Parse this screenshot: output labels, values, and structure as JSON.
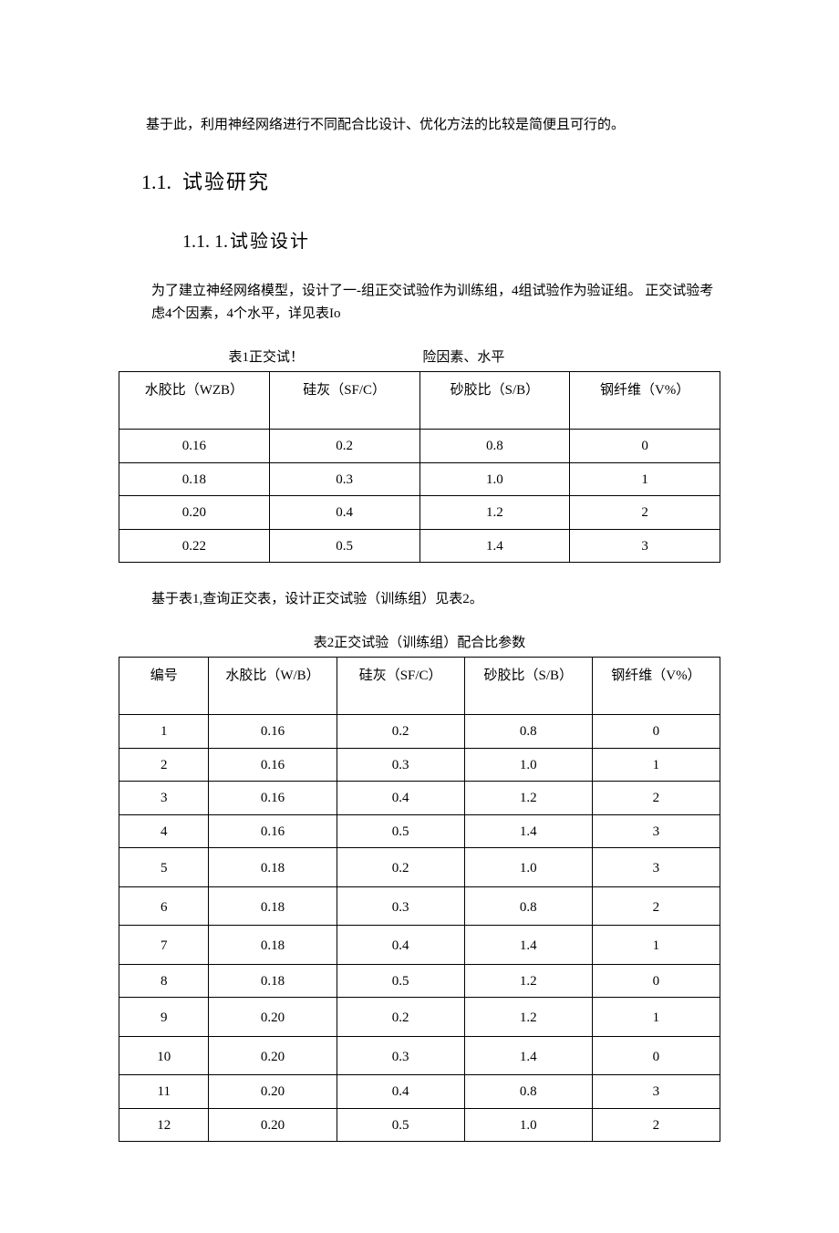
{
  "intro": "基于此，利用神经网络进行不同配合比设计、优化方法的比较是简便且可行的。",
  "heading_section_num": "1.1.",
  "heading_section_txt": "试验研究",
  "heading_sub_num": "1.1.  1.",
  "heading_sub_txt": "试验设计",
  "para_design_1": "为了建立神经网络模型，设计了一-组正交试验作为训练组，4组试验作为验证组。 正交试验考虑4个因素，4个水平，详见表Io",
  "table1_caption_left": "表1正交试！",
  "table1_caption_right": "险因素、水平",
  "table1": {
    "headers": [
      "水胶比（WZB）",
      "硅灰（SF/C）",
      "砂胶比（S/B）",
      "钢纤维（V%）"
    ],
    "rows": [
      [
        "0.16",
        "0.2",
        "0.8",
        "0"
      ],
      [
        "0.18",
        "0.3",
        "1.0",
        "1"
      ],
      [
        "0.20",
        "0.4",
        "1.2",
        "2"
      ],
      [
        "0.22",
        "0.5",
        "1.4",
        "3"
      ]
    ]
  },
  "mid_note": "基于表1,查询正交表，设计正交试验（训练组）见表2。",
  "table2_caption": "表2正交试验（训练组）配合比参数",
  "table2": {
    "headers": [
      "编号",
      "水胶比（W/B）",
      "硅灰（SF/C）",
      "砂胶比（S/B）",
      "钢纤维（V%）"
    ],
    "rows": [
      [
        "1",
        "0.16",
        "0.2",
        "0.8",
        "0"
      ],
      [
        "2",
        "0.16",
        "0.3",
        "1.0",
        "1"
      ],
      [
        "3",
        "0.16",
        "0.4",
        "1.2",
        "2"
      ],
      [
        "4",
        "0.16",
        "0.5",
        "1.4",
        "3"
      ],
      [
        "5",
        "0.18",
        "0.2",
        "1.0",
        "3"
      ],
      [
        "6",
        "0.18",
        "0.3",
        "0.8",
        "2"
      ],
      [
        "7",
        "0.18",
        "0.4",
        "1.4",
        "1"
      ],
      [
        "8",
        "0.18",
        "0.5",
        "1.2",
        "0"
      ],
      [
        "9",
        "0.20",
        "0.2",
        "1.2",
        "1"
      ],
      [
        "10",
        "0.20",
        "0.3",
        "1.4",
        "0"
      ],
      [
        "11",
        "0.20",
        "0.4",
        "0.8",
        "3"
      ],
      [
        "12",
        "0.20",
        "0.5",
        "1.0",
        "2"
      ]
    ]
  },
  "chart_data": [
    {
      "type": "table",
      "title": "表1 正交试险因素、水平",
      "headers": [
        "水胶比（WZB）",
        "硅灰（SF/C）",
        "砂胶比（S/B）",
        "钢纤维（V%）"
      ],
      "rows": [
        [
          0.16,
          0.2,
          0.8,
          0
        ],
        [
          0.18,
          0.3,
          1.0,
          1
        ],
        [
          0.2,
          0.4,
          1.2,
          2
        ],
        [
          0.22,
          0.5,
          1.4,
          3
        ]
      ]
    },
    {
      "type": "table",
      "title": "表2 正交试验（训练组）配合比参数",
      "headers": [
        "编号",
        "水胶比（W/B）",
        "硅灰（SF/C）",
        "砂胶比（S/B）",
        "钢纤维（V%）"
      ],
      "rows": [
        [
          1,
          0.16,
          0.2,
          0.8,
          0
        ],
        [
          2,
          0.16,
          0.3,
          1.0,
          1
        ],
        [
          3,
          0.16,
          0.4,
          1.2,
          2
        ],
        [
          4,
          0.16,
          0.5,
          1.4,
          3
        ],
        [
          5,
          0.18,
          0.2,
          1.0,
          3
        ],
        [
          6,
          0.18,
          0.3,
          0.8,
          2
        ],
        [
          7,
          0.18,
          0.4,
          1.4,
          1
        ],
        [
          8,
          0.18,
          0.5,
          1.2,
          0
        ],
        [
          9,
          0.2,
          0.2,
          1.2,
          1
        ],
        [
          10,
          0.2,
          0.3,
          1.4,
          0
        ],
        [
          11,
          0.2,
          0.4,
          0.8,
          3
        ],
        [
          12,
          0.2,
          0.5,
          1.0,
          2
        ]
      ]
    }
  ]
}
